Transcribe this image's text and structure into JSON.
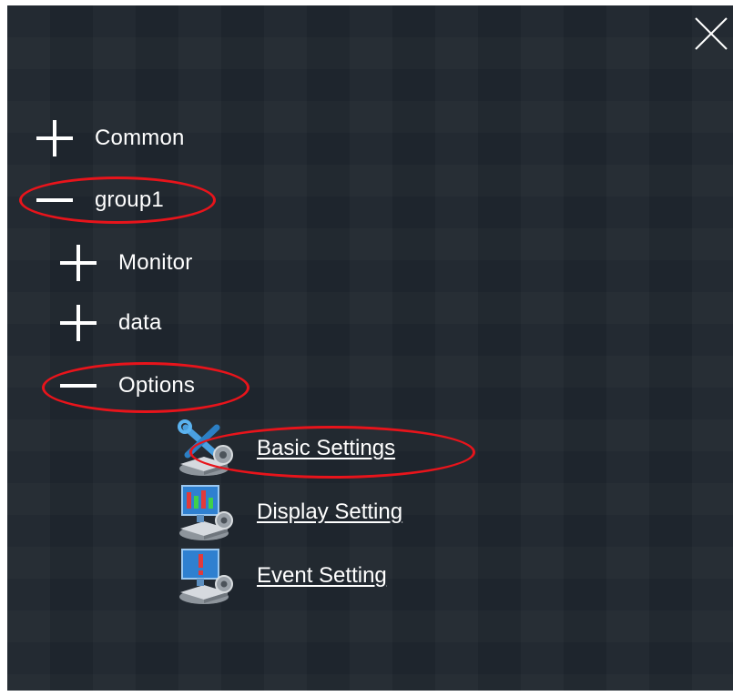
{
  "tree": {
    "common": {
      "label": "Common",
      "state": "collapsed"
    },
    "group1": {
      "label": "group1",
      "state": "expanded",
      "children": {
        "monitor": {
          "label": "Monitor",
          "state": "collapsed"
        },
        "data": {
          "label": "data",
          "state": "collapsed"
        },
        "options": {
          "label": "Options",
          "state": "expanded",
          "items": [
            {
              "label": "Basic Settings",
              "icon": "basic-settings-icon"
            },
            {
              "label": "Display Setting",
              "icon": "display-setting-icon"
            },
            {
              "label": "Event Setting",
              "icon": "event-setting-icon"
            }
          ]
        }
      }
    }
  },
  "annotations": {
    "highlighted": [
      "group1",
      "Options",
      "Basic Settings"
    ],
    "color": "#e8141b"
  },
  "colors": {
    "background": "#20272f",
    "text": "#ffffff"
  },
  "icons": {
    "close": "close-icon",
    "expand": "plus-icon",
    "collapse": "minus-icon"
  }
}
